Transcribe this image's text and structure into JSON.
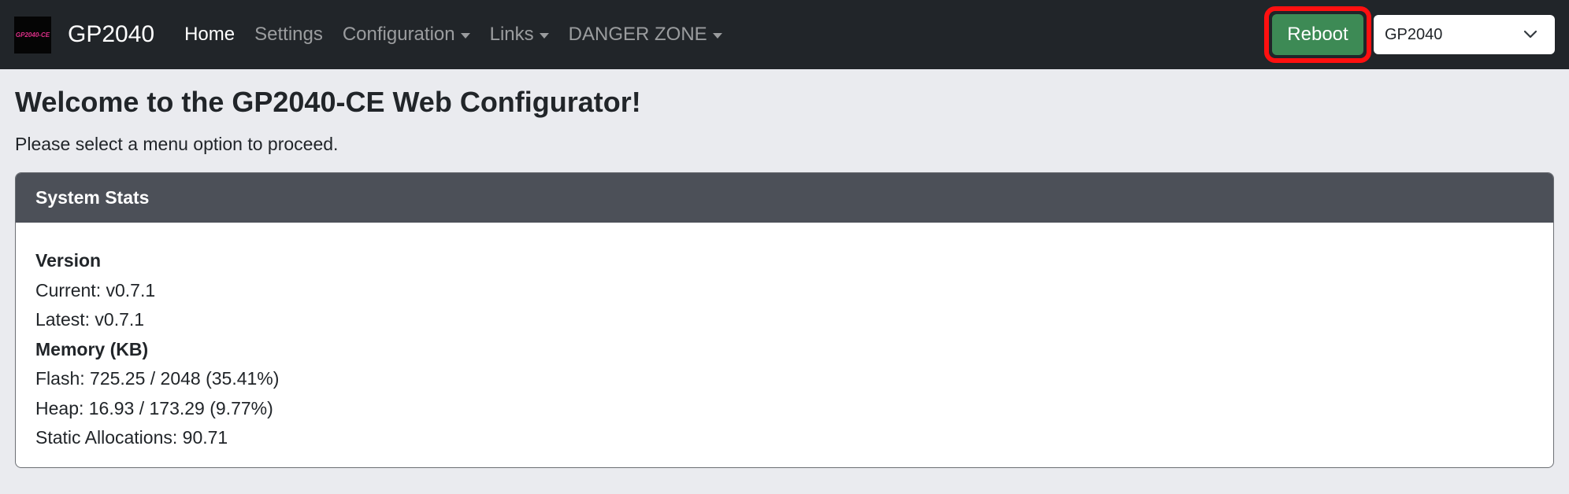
{
  "navbar": {
    "logo_text": "GP2040-CE",
    "brand": "GP2040",
    "links": [
      {
        "label": "Home"
      },
      {
        "label": "Settings"
      },
      {
        "label": "Configuration"
      },
      {
        "label": "Links"
      },
      {
        "label": "DANGER ZONE"
      }
    ],
    "reboot_label": "Reboot",
    "mode_select_value": "GP2040",
    "reboot_highlight_color": "#ff1010"
  },
  "page": {
    "title": "Welcome to the GP2040-CE Web Configurator!",
    "subtitle": "Please select a menu option to proceed."
  },
  "stats": {
    "header": "System Stats",
    "version_heading": "Version",
    "current": "Current: v0.7.1",
    "latest": "Latest: v0.7.1",
    "memory_heading": "Memory (KB)",
    "flash": "Flash: 725.25 / 2048 (35.41%)",
    "heap": "Heap: 16.93 / 173.29 (9.77%)",
    "static": "Static Allocations: 90.71"
  }
}
